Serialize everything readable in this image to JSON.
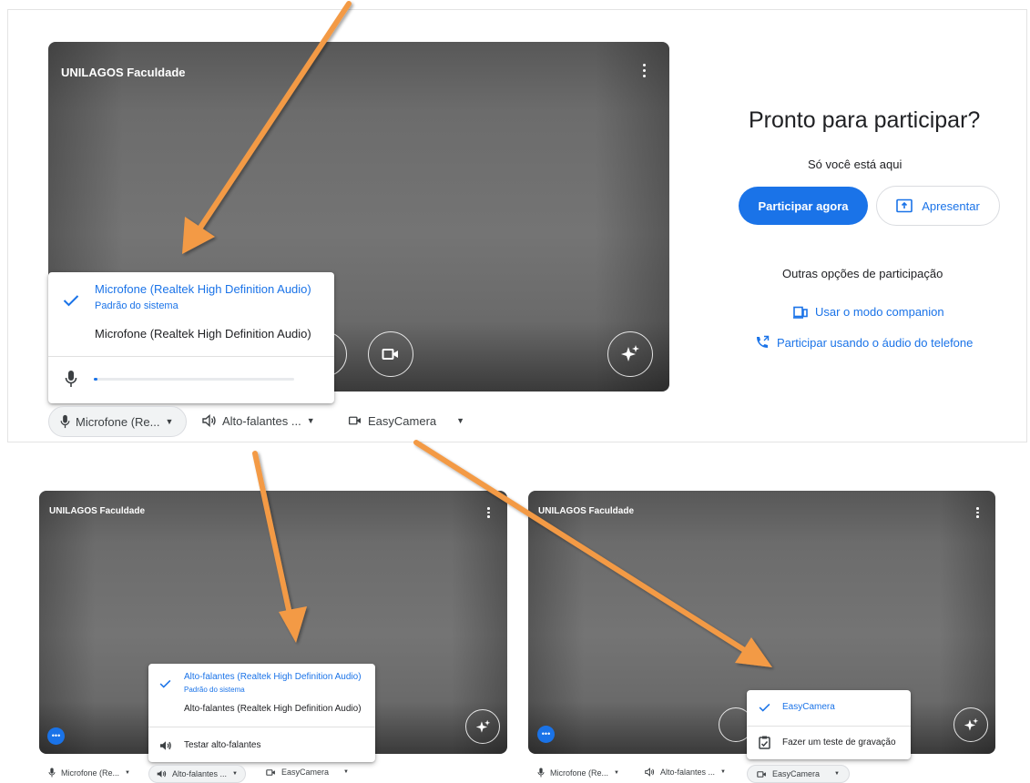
{
  "top": {
    "preview_title": "UNILAGOS Faculdade",
    "join": {
      "heading": "Pronto para participar?",
      "subtitle": "Só você está aqui",
      "join_now_label": "Participar agora",
      "present_label": "Apresentar",
      "other_options_label": "Outras opções de participação",
      "companion_label": "Usar o modo companion",
      "phone_label": "Participar usando o áudio do telefone"
    },
    "mic_menu": {
      "selected_label": "Microfone (Realtek High Definition Audio)",
      "selected_sub": "Padrão do sistema",
      "other_label": "Microfone (Realtek High Definition Audio)",
      "level": 0.02
    },
    "device_bar": {
      "mic_label": "Microfone (Re...",
      "speaker_label": "Alto-falantes ...",
      "camera_label": "EasyCamera"
    }
  },
  "bottom_left": {
    "preview_title": "UNILAGOS Faculdade",
    "speaker_menu": {
      "selected_label": "Alto-falantes (Realtek High Definition Audio)",
      "selected_sub": "Padrão do sistema",
      "other_label": "Alto-falantes (Realtek High Definition Audio)",
      "test_label": "Testar alto-falantes"
    },
    "device_bar": {
      "mic_label": "Microfone (Re...",
      "speaker_label": "Alto-falantes ...",
      "camera_label": "EasyCamera"
    }
  },
  "bottom_right": {
    "preview_title": "UNILAGOS Faculdade",
    "camera_menu": {
      "selected_label": "EasyCamera",
      "test_label": "Fazer um teste de gravação"
    },
    "device_bar": {
      "mic_label": "Microfone (Re...",
      "speaker_label": "Alto-falantes ...",
      "camera_label": "EasyCamera"
    }
  },
  "colors": {
    "accent": "#1a73e8",
    "arrow": "#f39a45"
  }
}
